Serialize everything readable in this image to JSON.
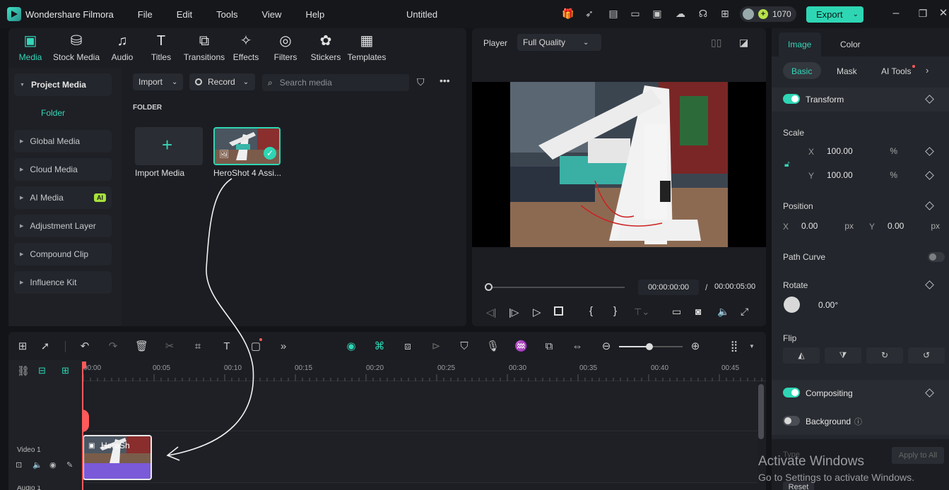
{
  "app": {
    "name": "Wondershare Filmora",
    "window_title": "Untitled"
  },
  "menu": [
    "File",
    "Edit",
    "Tools",
    "View",
    "Help"
  ],
  "header": {
    "credits": "1070",
    "export_label": "Export"
  },
  "toolbar": [
    {
      "label": "Media",
      "icon": "media-icon",
      "active": true
    },
    {
      "label": "Stock Media",
      "icon": "stock-media-icon"
    },
    {
      "label": "Audio",
      "icon": "audio-icon"
    },
    {
      "label": "Titles",
      "icon": "titles-icon"
    },
    {
      "label": "Transitions",
      "icon": "transitions-icon"
    },
    {
      "label": "Effects",
      "icon": "effects-icon"
    },
    {
      "label": "Filters",
      "icon": "filters-icon"
    },
    {
      "label": "Stickers",
      "icon": "stickers-icon"
    },
    {
      "label": "Templates",
      "icon": "templates-icon"
    }
  ],
  "sidebar": {
    "project_media": "Project Media",
    "folder": "Folder",
    "items": [
      "Global Media",
      "Cloud Media",
      "AI Media",
      "Adjustment Layer",
      "Compound Clip",
      "Influence Kit"
    ],
    "ai_badge": "AI"
  },
  "media": {
    "import_label": "Import",
    "record_label": "Record",
    "search_placeholder": "Search media",
    "folder_header": "FOLDER",
    "import_media_label": "Import Media",
    "clip_label": "HeroShot 4 Assi..."
  },
  "player": {
    "label": "Player",
    "quality": "Full Quality",
    "current_time": "00:00:00:00",
    "separator": "/",
    "total_time": "00:00:05:00"
  },
  "right_panel": {
    "tabs": [
      "Image",
      "Color"
    ],
    "subtabs": [
      "Basic",
      "Mask",
      "AI Tools"
    ],
    "transform": "Transform",
    "scale": "Scale",
    "scale_x_label": "X",
    "scale_y_label": "Y",
    "scale_x": "100.00",
    "scale_y": "100.00",
    "percent": "%",
    "position": "Position",
    "pos_x_label": "X",
    "pos_y_label": "Y",
    "pos_x": "0.00",
    "pos_y": "0.00",
    "px": "px",
    "path_curve": "Path Curve",
    "rotate": "Rotate",
    "rotate_value": "0.00°",
    "flip": "Flip",
    "compositing": "Compositing",
    "background": "Background",
    "type_label": "Type",
    "apply_all": "Apply to All",
    "reset": "Reset"
  },
  "timeline": {
    "ruler": [
      "00:00",
      "00:05",
      "00:10",
      "00:15",
      "00:20",
      "00:25",
      "00:30",
      "00:35",
      "00:40",
      "00:45"
    ],
    "track_label": "Video 1",
    "clip_label": "HeroSh",
    "audio_label": "Audio 1"
  },
  "watermark": {
    "title": "Activate Windows",
    "subtitle": "Go to Settings to activate Windows."
  },
  "colors": {
    "accent": "#2ed6b4",
    "bg": "#121418",
    "panel": "#1b1d22",
    "playhead": "#ff5a5a"
  }
}
